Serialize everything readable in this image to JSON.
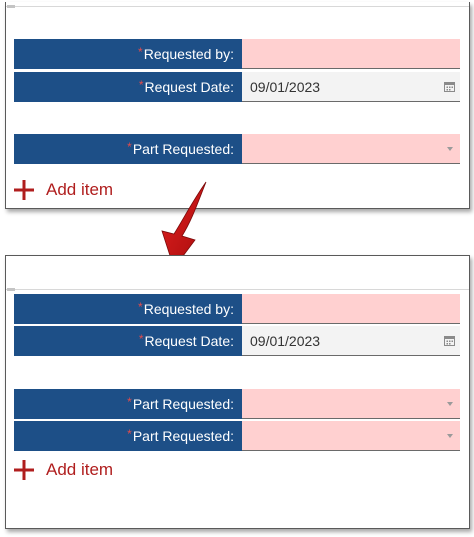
{
  "before": {
    "requested_by_label": "Requested by:",
    "request_date_label": "Request Date:",
    "request_date_value": "09/01/2023",
    "part_requested_label": "Part Requested:",
    "add_item_label": "Add item"
  },
  "after": {
    "requested_by_label": "Requested by:",
    "request_date_label": "Request Date:",
    "request_date_value": "09/01/2023",
    "part_requested_labels": [
      "Part Requested:",
      "Part Requested:"
    ],
    "add_item_label": "Add item"
  },
  "required_marker": "*",
  "colors": {
    "label_bg": "#1d4f87",
    "required_field_bg": "#ffd0d0",
    "date_field_bg": "#f3f3f3",
    "accent": "#b01e1e",
    "arrow": "#c01414"
  },
  "icons": {
    "date_picker": "calendar-icon",
    "dropdown": "chevron-down-icon",
    "add": "plus-icon",
    "transition": "curved-arrow-icon"
  }
}
